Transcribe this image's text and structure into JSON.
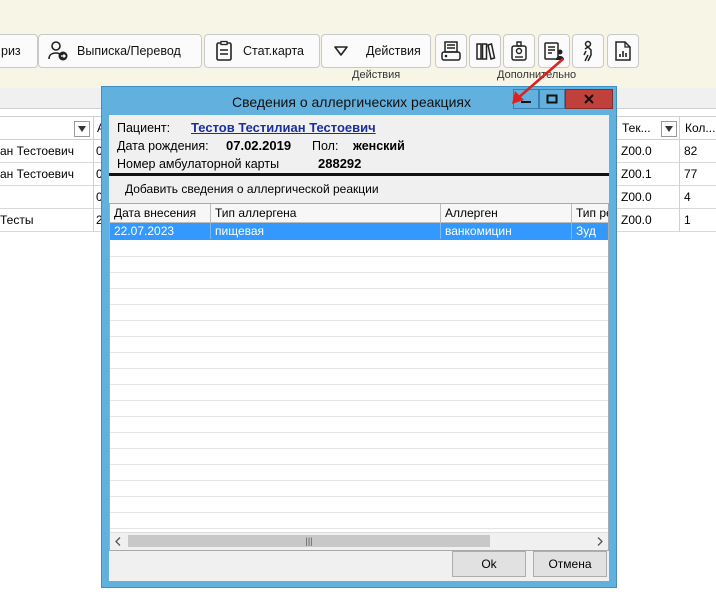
{
  "toolbar": {
    "partial_btn_label": "риз",
    "discharge_btn_label": "Выписка/Перевод",
    "statcard_btn_label": "Стат.карта",
    "actions_btn_label": "Действия",
    "group_actions_label": "Действия",
    "group_extra_label": "Дополнительно",
    "icons": [
      "card-reader-icon",
      "books-icon",
      "badge-icon",
      "document-user-icon",
      "person-icon",
      "chart-document-icon"
    ]
  },
  "background_table": {
    "col_partial_header": "А",
    "headers": [
      "Тек...",
      "Кол..."
    ],
    "rows": [
      {
        "name": "ан Тестоевич",
        "c2": "0",
        "code": "Z00.0",
        "count": "82"
      },
      {
        "name": "ан Тестоевич",
        "c2": "0",
        "code": "Z00.1",
        "count": "77"
      },
      {
        "name": "",
        "c2": "0",
        "code": "Z00.0",
        "count": "4"
      },
      {
        "name": "Тесты",
        "c2": "2",
        "code": "Z00.0",
        "count": "1"
      }
    ]
  },
  "dialog": {
    "title": "Сведения о аллергических реакциях",
    "patient_label": "Пациент:",
    "patient_name": "Тестов Тестилиан Тестоевич",
    "dob_label": "Дата рождения:",
    "dob_value": "07.02.2019",
    "sex_label": "Пол:",
    "sex_value": "женский",
    "card_label": "Номер амбулаторной карты",
    "card_value": "288292",
    "add_link": "Добавить сведения о аллергической реакции",
    "grid": {
      "headers": [
        "Дата внесения",
        "Тип аллергена",
        "Аллерген",
        "Тип ре"
      ],
      "rows": [
        {
          "date": "22.07.2023",
          "type": "пищевая",
          "allergen": "ванкомицин",
          "reaction": "Зуд"
        }
      ]
    },
    "ok_label": "Ok",
    "cancel_label": "Отмена"
  },
  "colors": {
    "dialog_frame": "#62b0dd",
    "close_button": "#c0403b",
    "selection": "#3399ff",
    "toolbar_bg": "#f7f5e6",
    "annotation_arrow": "#e0201f",
    "patient_link": "#1a2fa0"
  }
}
